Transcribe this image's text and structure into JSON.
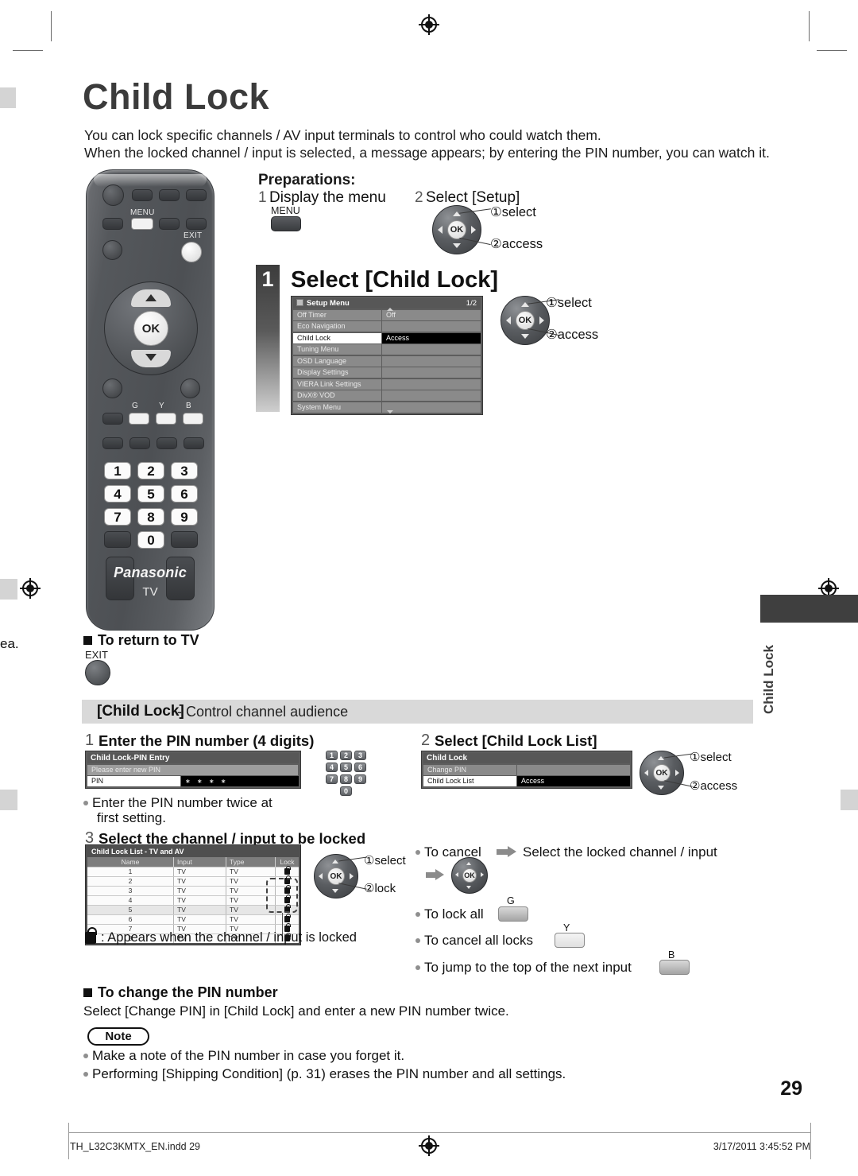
{
  "page": {
    "title": "Child Lock",
    "number": "29",
    "side_tab_label": "Child Lock",
    "left_margin_text": "ea."
  },
  "intro": {
    "line1": "You can lock specific channels / AV input terminals to control who could watch them.",
    "line2": "When the locked channel / input is selected, a message appears; by entering the PIN number, you can watch it."
  },
  "remote": {
    "menu_label": "MENU",
    "exit_label": "EXIT",
    "ok_label": "OK",
    "colour_keys": [
      "G",
      "Y",
      "B"
    ],
    "numbers": [
      "1",
      "2",
      "3",
      "4",
      "5",
      "6",
      "7",
      "8",
      "9",
      "0"
    ],
    "brand": "Panasonic",
    "brand_sub": "TV"
  },
  "preparations": {
    "heading": "Preparations:",
    "steps": [
      {
        "num": "1",
        "text": "Display the menu",
        "key_label": "MENU"
      },
      {
        "num": "2",
        "text": "Select [Setup]",
        "pad_captions": [
          "①select",
          "②access"
        ]
      }
    ]
  },
  "step1": {
    "num": "1",
    "title": "Select [Child Lock]",
    "pad_captions": [
      "①select",
      "②access"
    ],
    "osd": {
      "title": "Setup Menu",
      "page": "1/2",
      "rows": [
        {
          "label": "Off Timer",
          "value": "Off",
          "selected": false
        },
        {
          "label": "Eco Navigation",
          "value": "",
          "selected": false
        },
        {
          "label": "Child Lock",
          "value": "Access",
          "selected": true
        },
        {
          "label": "Tuning Menu",
          "value": "",
          "selected": false
        },
        {
          "label": "OSD Language",
          "value": "",
          "selected": false
        },
        {
          "label": "Display Settings",
          "value": "",
          "selected": false
        },
        {
          "label": "VIERA Link Settings",
          "value": "",
          "selected": false
        },
        {
          "label": "DivX® VOD",
          "value": "",
          "selected": false
        },
        {
          "label": "System Menu",
          "value": "",
          "selected": false
        }
      ]
    }
  },
  "return_to_tv": {
    "heading": "To return to TV",
    "key_label": "EXIT"
  },
  "banner": {
    "strong": "[Child Lock]",
    "rest": "- Control channel audience"
  },
  "pin_step": {
    "num": "1",
    "heading": "Enter the PIN number (4 digits)",
    "osd": {
      "title": "Child Lock-PIN Entry",
      "subtitle": "Please enter new PIN",
      "field_label": "PIN",
      "field_value": "∗ ∗ ∗ ∗"
    },
    "keypad": [
      "1",
      "2",
      "3",
      "4",
      "5",
      "6",
      "7",
      "8",
      "9",
      "0"
    ],
    "bullet_line1": "Enter the PIN number twice at",
    "bullet_line2": "first setting."
  },
  "list_step": {
    "num": "2",
    "heading": "Select [Child Lock List]",
    "osd": {
      "title": "Child Lock",
      "rows": [
        {
          "label": "Change PIN",
          "value": "",
          "selected": false
        },
        {
          "label": "Child Lock List",
          "value": "Access",
          "selected": true
        }
      ]
    },
    "pad_captions": [
      "①select",
      "②access"
    ]
  },
  "select_step": {
    "num": "3",
    "heading": "Select the channel / input to be locked",
    "pad_captions": [
      "①select",
      "②lock"
    ],
    "table": {
      "title": "Child Lock List - TV and AV",
      "columns": [
        "Name",
        "Input",
        "Type",
        "Lock"
      ],
      "rows": [
        {
          "name": "1",
          "input": "TV",
          "type": "TV",
          "lock": "locked"
        },
        {
          "name": "2",
          "input": "TV",
          "type": "TV",
          "lock": "locked"
        },
        {
          "name": "3",
          "input": "TV",
          "type": "TV",
          "lock": "locked"
        },
        {
          "name": "4",
          "input": "TV",
          "type": "TV",
          "lock": "locked"
        },
        {
          "name": "5",
          "input": "TV",
          "type": "TV",
          "lock": "locked"
        },
        {
          "name": "6",
          "input": "TV",
          "type": "TV",
          "lock": "locked"
        },
        {
          "name": "7",
          "input": "TV",
          "type": "TV",
          "lock": "locked"
        },
        {
          "name": "8",
          "input": "TV",
          "type": "TV",
          "lock": "locked"
        }
      ]
    },
    "legend": ": Appears when the channel / input is locked",
    "tips": [
      {
        "text": "To cancel",
        "after": "Select the locked channel / input",
        "has_arrow": true
      },
      {
        "text": "To lock all",
        "key": "G"
      },
      {
        "text": "To cancel all locks",
        "key": "Y"
      },
      {
        "text": "To jump to the top of the next input",
        "key": "B"
      }
    ]
  },
  "change_pin": {
    "heading": "To change the PIN number",
    "body": "Select [Change PIN] in [Child Lock] and enter a new PIN number twice."
  },
  "note": {
    "label": "Note",
    "lines": [
      "Make a note of the PIN number in case you forget it.",
      "Performing [Shipping Condition] (p. 31) erases the PIN number and all settings."
    ]
  },
  "footer": {
    "left": "TH_L32C3KMTX_EN.indd   29",
    "right": "3/17/2011   3:45:52 PM"
  },
  "colors": {
    "title_gray": "#3b3b3b",
    "banner_gray": "#d9d9d9",
    "osd_gray": "#8a8a8a",
    "selected_black": "#000000",
    "side_tab": "#3f3f3f"
  }
}
